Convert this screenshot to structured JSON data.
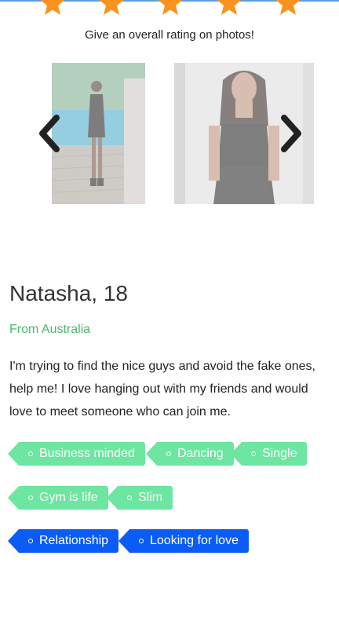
{
  "rating": {
    "prompt": "Give an overall rating on photos!",
    "stars": 5,
    "star_color": "#f7931e"
  },
  "gallery": {
    "photos": [
      {
        "icon": "woman-photo"
      },
      {
        "icon": "woman-photo"
      }
    ],
    "prev_icon": "chevron-left-icon",
    "next_icon": "chevron-right-icon"
  },
  "profile": {
    "name_age": "Natasha, 18",
    "origin": "From Australia",
    "bio": "I'm trying to find the nice guys and avoid the fake ones, help me! I love hanging out with my friends and would love to meet someone who can join me."
  },
  "tags": [
    {
      "label": "Business minded",
      "color": "#6ce6a0"
    },
    {
      "label": "Dancing",
      "color": "#6ce6a0"
    },
    {
      "label": "Single",
      "color": "#6ce6a0"
    },
    {
      "label": "Gym is life",
      "color": "#6ce6a0"
    },
    {
      "label": "Slim",
      "color": "#6ce6a0"
    },
    {
      "label": "Relationship",
      "color": "#0a5cf5"
    },
    {
      "label": "Looking for love",
      "color": "#0a5cf5"
    }
  ]
}
